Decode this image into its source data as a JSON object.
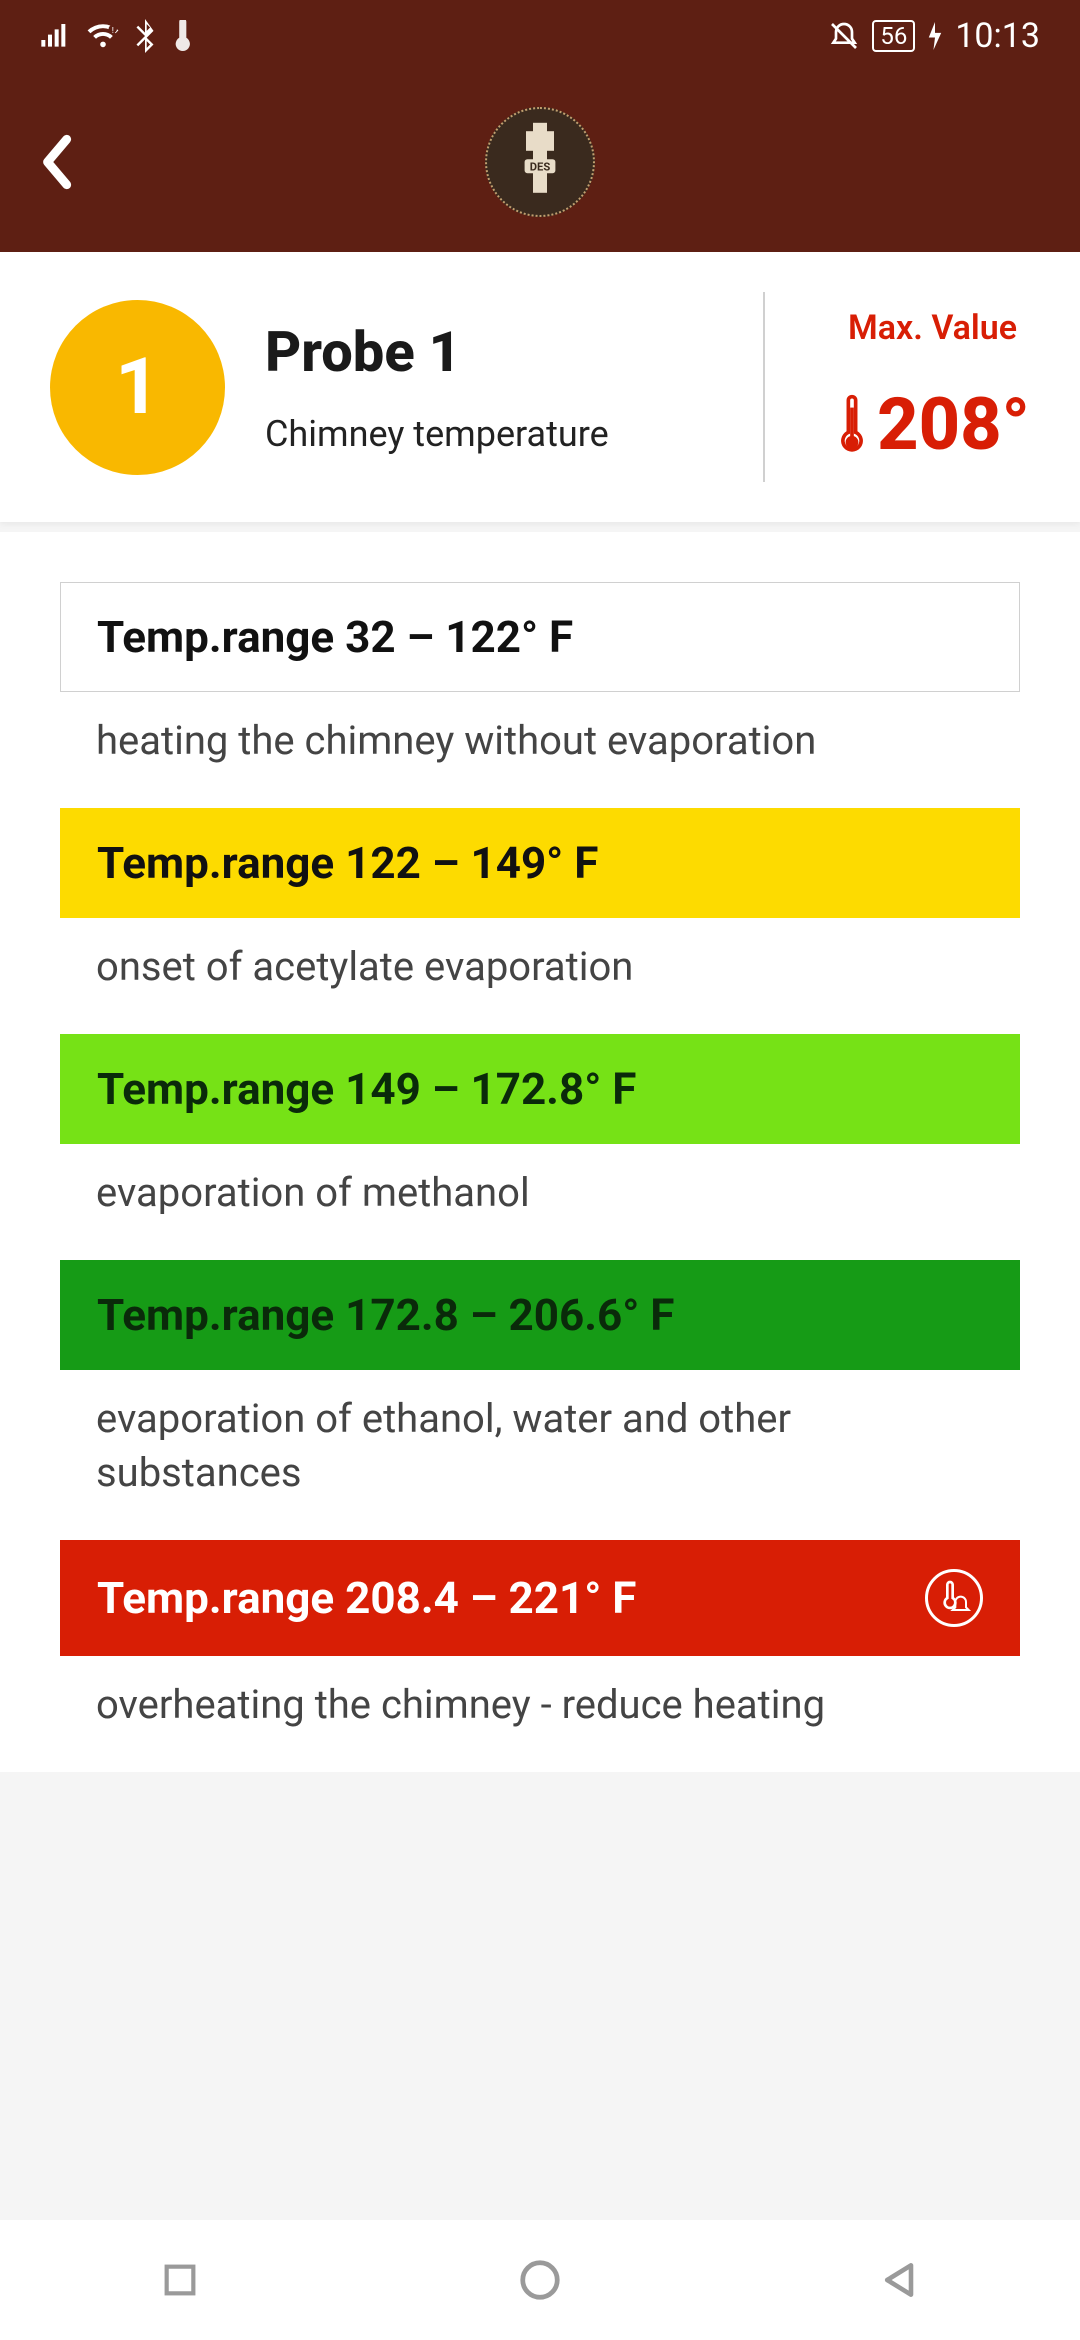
{
  "status": {
    "battery": "56",
    "time": "10:13"
  },
  "header": {
    "logo_text": "DES"
  },
  "probe": {
    "number": "1",
    "title": "Probe 1",
    "subtitle": "Chimney temperature",
    "max_label": "Max. Value",
    "max_value": "208°"
  },
  "ranges": [
    {
      "label": "Temp.range 32 – 122° F",
      "desc": "heating the chimney without evaporation"
    },
    {
      "label": "Temp.range 122 – 149° F",
      "desc": "onset of acetylate evaporation"
    },
    {
      "label": "Temp.range 149 – 172.8° F",
      "desc": "evaporation of methanol"
    },
    {
      "label": "Temp.range 172.8 – 206.6° F",
      "desc": "evaporation of ethanol, water and other substances"
    },
    {
      "label": "Temp.range 208.4 – 221° F",
      "desc": "overheating the chimney - reduce heating"
    }
  ]
}
